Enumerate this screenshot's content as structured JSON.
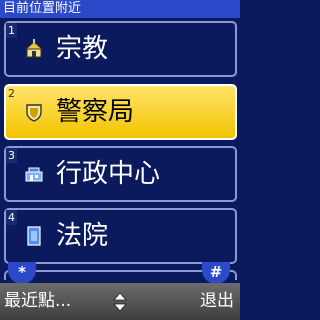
{
  "title": "目前位置附近",
  "items": [
    {
      "number": "1",
      "label": "宗教",
      "icon": "church-icon",
      "selected": false
    },
    {
      "number": "2",
      "label": "警察局",
      "icon": "police-badge-icon",
      "selected": true
    },
    {
      "number": "3",
      "label": "行政中心",
      "icon": "government-icon",
      "selected": false
    },
    {
      "number": "4",
      "label": "法院",
      "icon": "courthouse-icon",
      "selected": false
    }
  ],
  "keys": {
    "star": "*",
    "hash": "#"
  },
  "softkeys": {
    "left": "最近點...",
    "right": "退出"
  },
  "colors": {
    "background": "#0a1a5c",
    "titlebar": "#2b49c8",
    "selected": "#f2c400",
    "softbar": "#555555"
  }
}
